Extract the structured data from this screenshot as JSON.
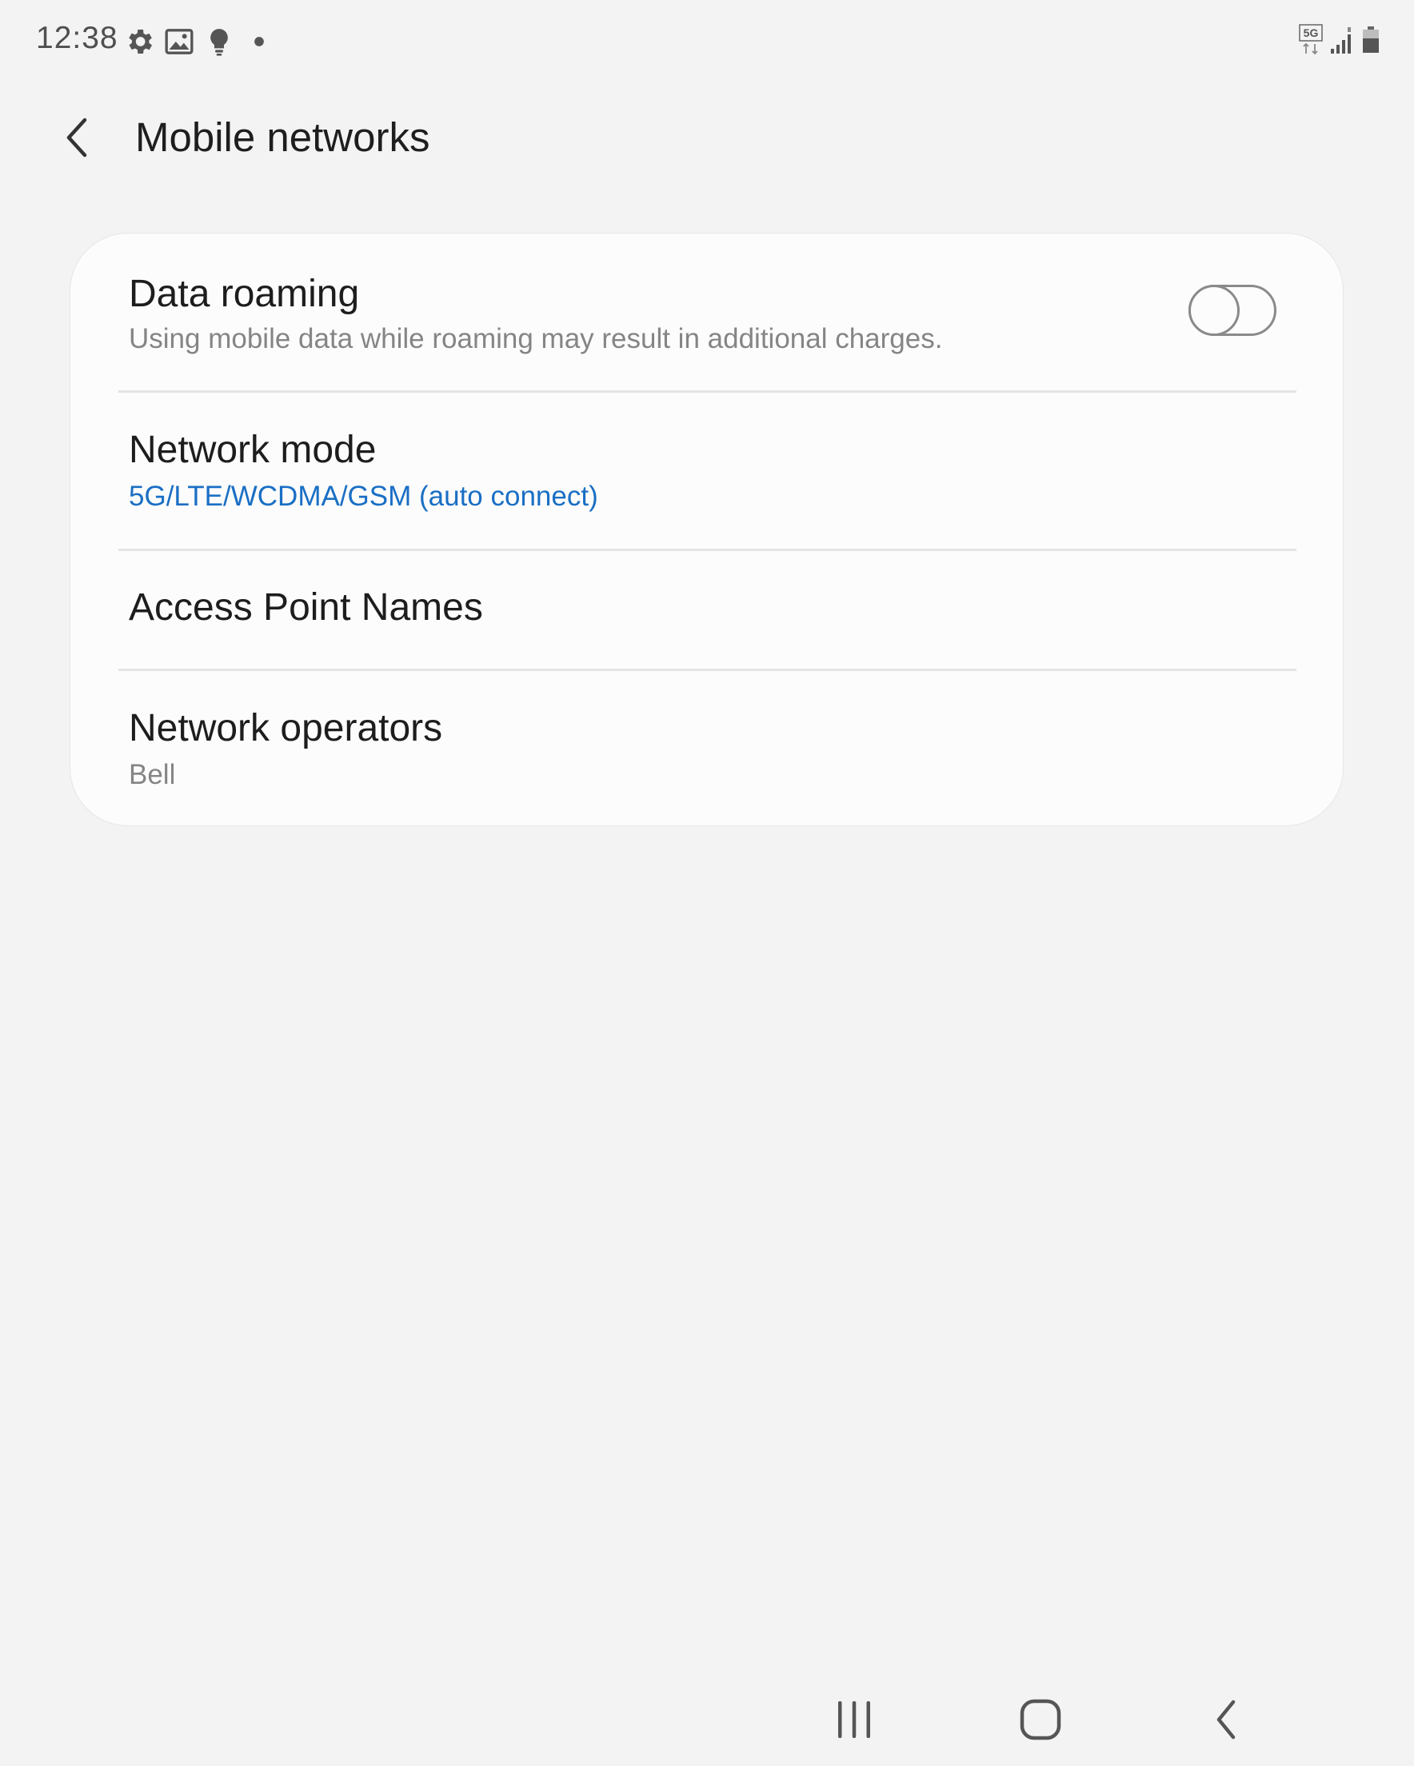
{
  "status_bar": {
    "time": "12:38",
    "left_icons": [
      "gear-icon",
      "image-icon",
      "lightbulb-icon",
      "dot-icon"
    ],
    "network_type": "5G",
    "right_icons": [
      "5g-data-icon",
      "signal-icon",
      "battery-icon"
    ]
  },
  "header": {
    "title": "Mobile networks",
    "back_icon": "chevron-left-icon"
  },
  "settings": {
    "data_roaming": {
      "title": "Data roaming",
      "subtitle": "Using mobile data while roaming may result in additional charges.",
      "enabled": false
    },
    "network_mode": {
      "title": "Network mode",
      "value": "5G/LTE/WCDMA/GSM (auto connect)"
    },
    "access_point_names": {
      "title": "Access Point Names"
    },
    "network_operators": {
      "title": "Network operators",
      "value": "Bell"
    }
  },
  "nav_bar": {
    "buttons": [
      "recents-icon",
      "home-icon",
      "back-icon"
    ]
  },
  "colors": {
    "background": "#f3f3f3",
    "card": "#fcfcfc",
    "accent": "#1a6fc4",
    "secondary_text": "#858585"
  }
}
